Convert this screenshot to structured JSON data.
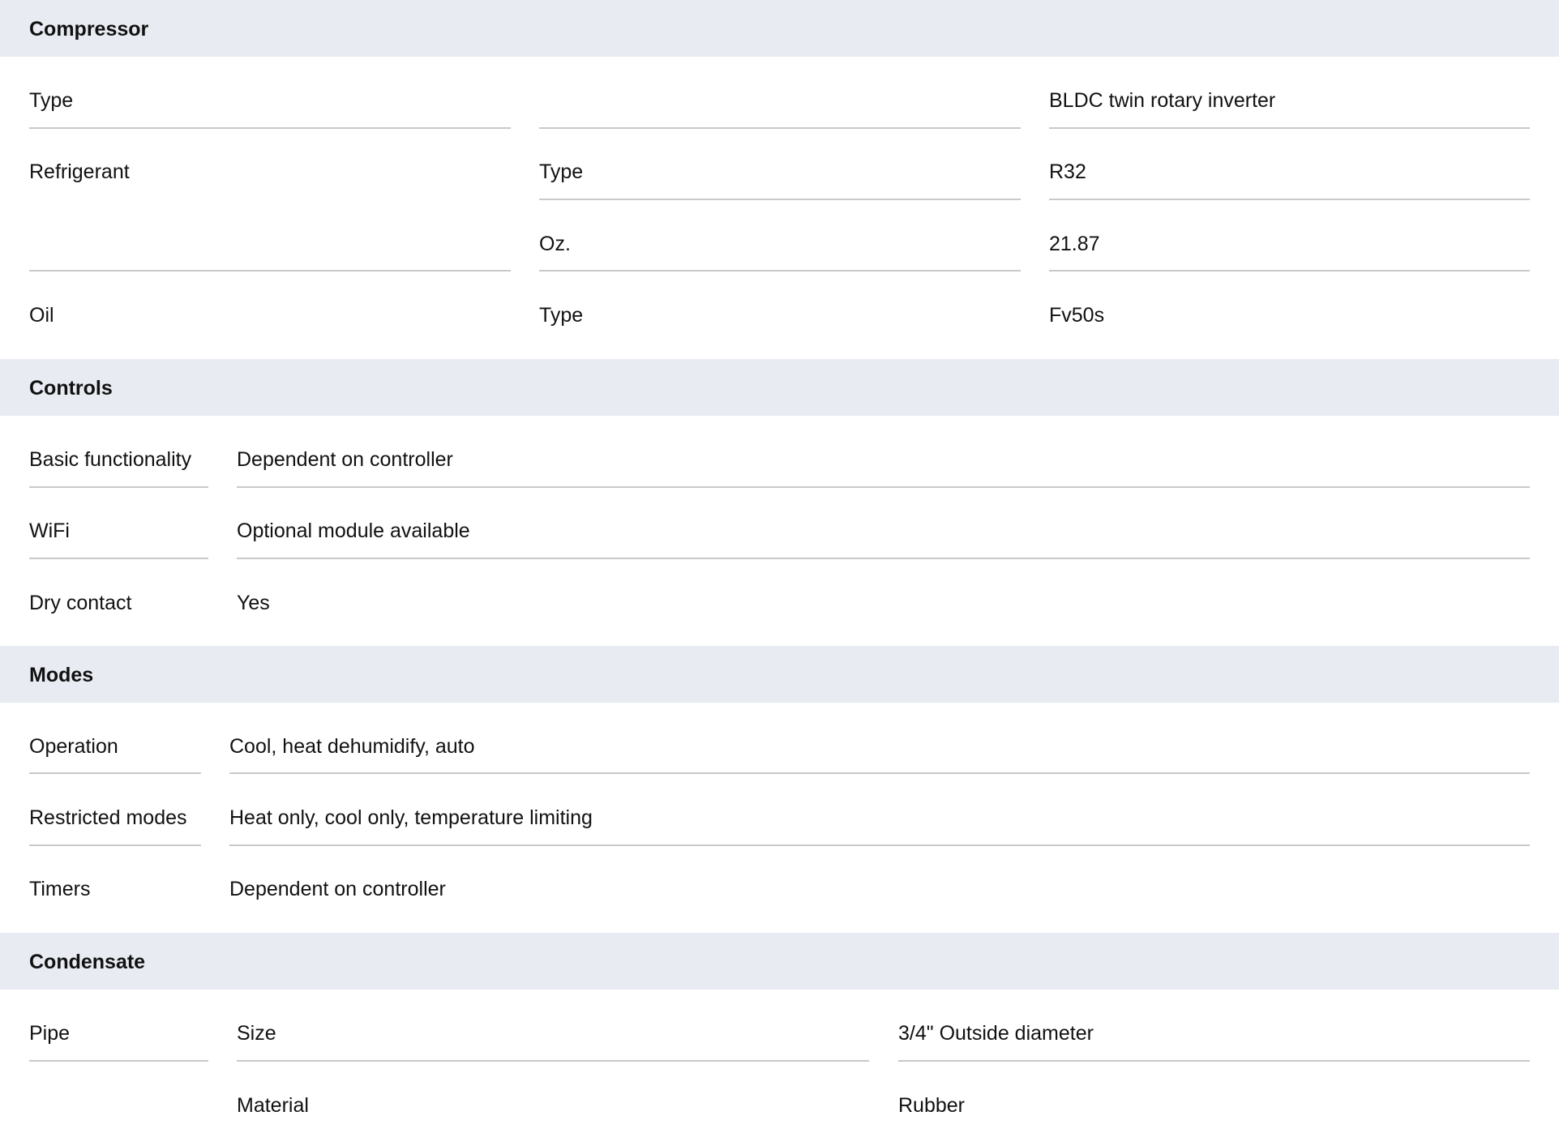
{
  "compressor": {
    "title": "Compressor",
    "type_label": "Type",
    "type_value": "BLDC twin rotary inverter",
    "refrigerant_label": "Refrigerant",
    "refrigerant_type_label": "Type",
    "refrigerant_type_value": "R32",
    "refrigerant_oz_label": "Oz.",
    "refrigerant_oz_value": "21.87",
    "oil_label": "Oil",
    "oil_type_label": "Type",
    "oil_type_value": "Fv50s"
  },
  "controls": {
    "title": "Controls",
    "rows": [
      {
        "label": "Basic functionality",
        "value": "Dependent on controller"
      },
      {
        "label": "WiFi",
        "value": "Optional module available"
      },
      {
        "label": "Dry contact",
        "value": "Yes"
      }
    ]
  },
  "modes": {
    "title": "Modes",
    "rows": [
      {
        "label": "Operation",
        "value": "Cool, heat dehumidify, auto"
      },
      {
        "label": "Restricted modes",
        "value": "Heat only, cool only, temperature limiting"
      },
      {
        "label": "Timers",
        "value": "Dependent on controller"
      }
    ]
  },
  "condensate": {
    "title": "Condensate",
    "pipe_label": "Pipe",
    "size_label": "Size",
    "size_value": "3/4\" Outside diameter",
    "material_label": "Material",
    "material_value": "Rubber"
  }
}
